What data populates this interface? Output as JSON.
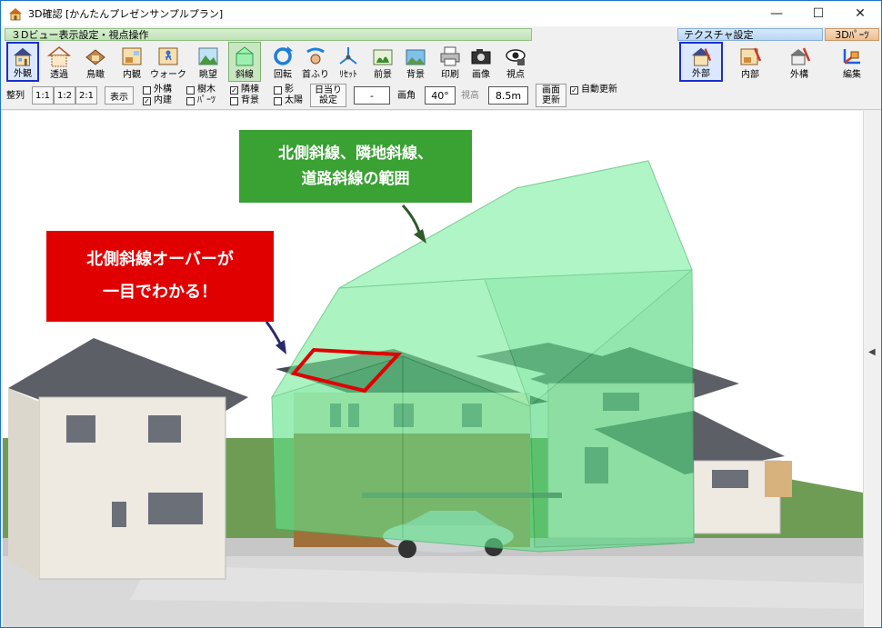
{
  "window": {
    "title": "3D確認 [かんたんプレゼンサンプルプラン]",
    "minimize": "—",
    "maximize": "☐",
    "close": "✕"
  },
  "toolbar": {
    "view_group_title": "３Dビュー表示設定・視点操作",
    "texture_group_title": "テクスチャ設定",
    "parts_group_title": "3Dﾊﾟｰﾂ",
    "view_buttons": [
      {
        "label": "外観",
        "icon": "house-exterior-icon"
      },
      {
        "label": "透過",
        "icon": "transparent-house-icon"
      },
      {
        "label": "鳥瞰",
        "icon": "birdseye-house-icon"
      },
      {
        "label": "内観",
        "icon": "interior-icon"
      },
      {
        "label": "ウォーク",
        "icon": "walk-icon"
      },
      {
        "label": "眺望",
        "icon": "landscape-icon"
      },
      {
        "label": "斜線",
        "icon": "diagonal-line-icon"
      },
      {
        "label": "回転",
        "icon": "rotate-icon"
      },
      {
        "label": "首ふり",
        "icon": "head-turn-icon"
      },
      {
        "label": "ﾘｾｯﾄ",
        "icon": "reset-icon"
      },
      {
        "label": "前景",
        "icon": "foreground-icon"
      },
      {
        "label": "背景",
        "icon": "background-icon"
      },
      {
        "label": "印刷",
        "icon": "printer-icon"
      },
      {
        "label": "画像",
        "icon": "camera-icon"
      },
      {
        "label": "視点",
        "icon": "eye-icon"
      }
    ],
    "texture_buttons": [
      {
        "label": "外部",
        "icon": "exterior-paint-icon"
      },
      {
        "label": "内部",
        "icon": "interior-paint-icon"
      },
      {
        "label": "外構",
        "icon": "exterior-works-icon"
      }
    ],
    "parts_button": {
      "label": "編集",
      "icon": "parts-edit-icon"
    }
  },
  "options": {
    "align_label": "整列",
    "ratio_1_1": "1:1",
    "ratio_1_2": "1:2",
    "ratio_2_1": "2:1",
    "display_button": "表示",
    "checkboxes": [
      {
        "label": "外構",
        "checked": false
      },
      {
        "label": "内建",
        "checked": true
      },
      {
        "label": "樹木",
        "checked": false
      },
      {
        "label": "ﾊﾟｰﾂ",
        "checked": false
      },
      {
        "label": "隣棟",
        "checked": true
      },
      {
        "label": "背景",
        "checked": false
      },
      {
        "label": "影",
        "checked": false
      },
      {
        "label": "太陽",
        "checked": false
      }
    ],
    "sun_setting_line1": "日当り",
    "sun_setting_line2": "設定",
    "dash_field": "-",
    "view_angle_label": "画角",
    "view_angle_value": "40°",
    "eye_height_label": "視高",
    "eye_height_value": "8.5m",
    "refresh_line1": "画面",
    "refresh_line2": "更新",
    "auto_refresh_label": "自動更新",
    "auto_refresh_checked": true
  },
  "callouts": {
    "green_line1": "北側斜線、隣地斜線、",
    "green_line2": "道路斜線の範囲",
    "red_line1": "北側斜線オーバーが",
    "red_line2": "一目でわかる！"
  },
  "colors": {
    "green_callout": "#3aa133",
    "red_callout": "#e10000",
    "setback_volume": "#5fe38a",
    "active_border": "#1a2fd0"
  }
}
